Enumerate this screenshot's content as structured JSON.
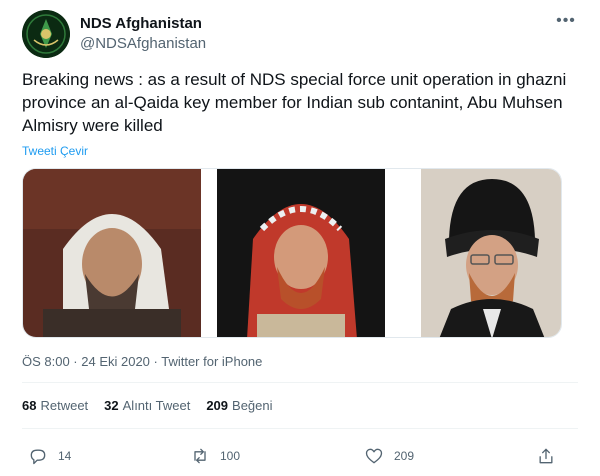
{
  "account": {
    "display_name": "NDS Afghanistan",
    "handle": "@NDSAfghanistan",
    "more_icon": "more-horizontal-icon"
  },
  "tweet": {
    "text": "Breaking news : as a result of NDS special force unit operation in ghazni province an al-Qaida key member for Indian sub contanint, Abu Muhsen Almisry were killed",
    "translate_label": "Tweeti Çevir",
    "meta": "ÖS 8:00 · 24 Eki 2020 · Twitter for iPhone"
  },
  "stats": {
    "retweets_count": "68",
    "retweets_label": "Retweet",
    "quotes_count": "32",
    "quotes_label": "Alıntı Tweet",
    "likes_count": "209",
    "likes_label": "Beğeni"
  },
  "actions": {
    "reply_count": "14",
    "retweet_count": "100",
    "like_count": "209"
  },
  "colors": {
    "link": "#1d9bf0",
    "secondary_text": "#536471",
    "primary_text": "#0f1419"
  }
}
